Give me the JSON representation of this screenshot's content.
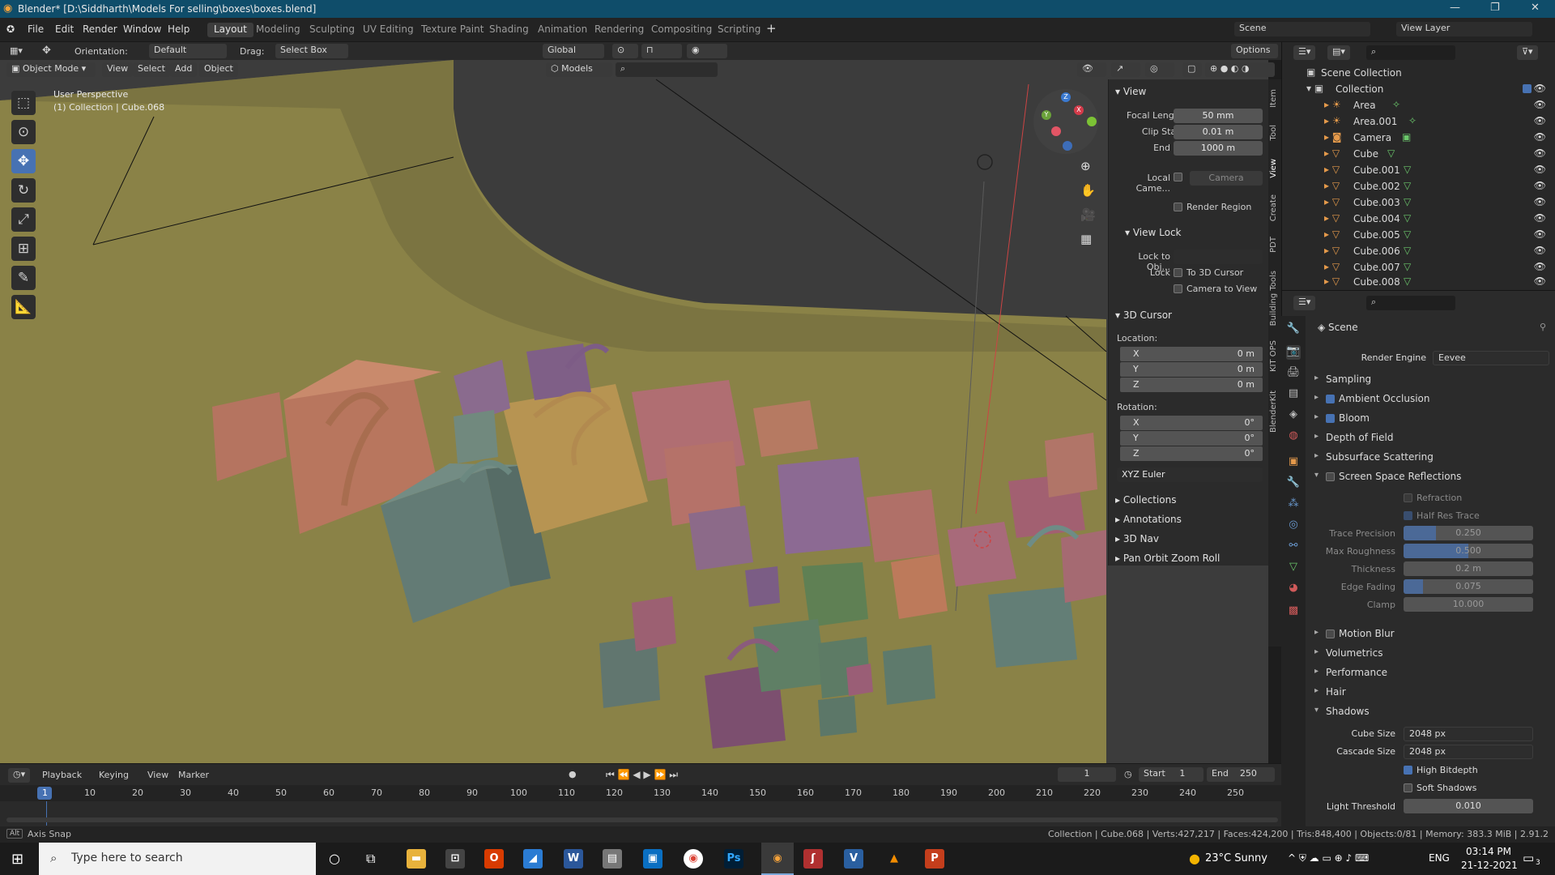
{
  "title_bar": {
    "title": "Blender* [D:\\Siddharth\\Models For selling\\boxes\\boxes.blend]"
  },
  "menu": [
    "File",
    "Edit",
    "Render",
    "Window",
    "Help"
  ],
  "workspaces": [
    "Layout",
    "Modeling",
    "Sculpting",
    "UV Editing",
    "Texture Paint",
    "Shading",
    "Animation",
    "Rendering",
    "Compositing",
    "Scripting"
  ],
  "scene_selector": "Scene",
  "view_layer": "View Layer",
  "tool_header": {
    "orientation_label": "Orientation:",
    "orientation_value": "Default",
    "drag_label": "Drag:",
    "drag_value": "Select Box",
    "transform_orientation": "Global",
    "options": "Options"
  },
  "viewport_header": {
    "mode": "Object Mode",
    "view": "View",
    "select": "Select",
    "add": "Add",
    "object": "Object",
    "asset_lib": "Models"
  },
  "viewport_overlay": {
    "perspective": "User Perspective",
    "collection": "(1) Collection | Cube.068"
  },
  "npanel": {
    "view_section": "View",
    "focal_length_label": "Focal Length",
    "focal_length": "50 mm",
    "clip_start_label": "Clip Start",
    "clip_start": "0.01 m",
    "end_label": "End",
    "clip_end": "1000 m",
    "local_camera_label": "Local Came...",
    "local_camera_value": "Camera",
    "render_region": "Render Region",
    "view_lock_section": "View Lock",
    "lock_to_obj_label": "Lock to Obj...",
    "lock_label": "Lock",
    "to_3d_cursor": "To 3D Cursor",
    "camera_to_view": "Camera to View",
    "cursor_section": "3D Cursor",
    "location_label": "Location:",
    "loc_x": "0 m",
    "loc_y": "0 m",
    "loc_z": "0 m",
    "rotation_label": "Rotation:",
    "rot_x": "0°",
    "rot_y": "0°",
    "rot_z": "0°",
    "rotation_mode": "XYZ Euler",
    "collections": "Collections",
    "annotations": "Annotations",
    "nav_3d": "3D Nav",
    "pan_orbit": "Pan Orbit Zoom Roll",
    "tabs": [
      "Item",
      "Tool",
      "View",
      "Create",
      "PDT",
      "Building Tools",
      "KIT OPS",
      "BlenderKit"
    ]
  },
  "outliner": {
    "scene_collection": "Scene Collection",
    "collection": "Collection",
    "items": [
      "Area",
      "Area.001",
      "Camera",
      "Cube",
      "Cube.001",
      "Cube.002",
      "Cube.003",
      "Cube.004",
      "Cube.005",
      "Cube.006",
      "Cube.007",
      "Cube.008"
    ]
  },
  "properties": {
    "scene": "Scene",
    "render_engine_label": "Render Engine",
    "render_engine": "Eevee",
    "sampling": "Sampling",
    "ambient_occlusion": "Ambient Occlusion",
    "bloom": "Bloom",
    "depth_of_field": "Depth of Field",
    "subsurface_scattering": "Subsurface Scattering",
    "ssr": "Screen Space Reflections",
    "refraction": "Refraction",
    "half_res_trace": "Half Res Trace",
    "trace_precision_label": "Trace Precision",
    "trace_precision": "0.250",
    "max_roughness_label": "Max Roughness",
    "max_roughness": "0.500",
    "thickness_label": "Thickness",
    "thickness": "0.2 m",
    "edge_fading_label": "Edge Fading",
    "edge_fading": "0.075",
    "clamp_label": "Clamp",
    "clamp": "10.000",
    "motion_blur": "Motion Blur",
    "volumetrics": "Volumetrics",
    "performance": "Performance",
    "hair": "Hair",
    "shadows": "Shadows",
    "cube_size_label": "Cube Size",
    "cube_size": "2048 px",
    "cascade_size_label": "Cascade Size",
    "cascade_size": "2048 px",
    "high_bitdepth": "High Bitdepth",
    "soft_shadows": "Soft Shadows",
    "light_threshold_label": "Light Threshold",
    "light_threshold": "0.010"
  },
  "timeline": {
    "playback": "Playback",
    "keying": "Keying",
    "view": "View",
    "marker": "Marker",
    "current_frame": "1",
    "start_label": "Start",
    "start": "1",
    "end_label": "End",
    "end": "250",
    "ticks": [
      "1",
      "10",
      "20",
      "30",
      "40",
      "50",
      "60",
      "70",
      "80",
      "90",
      "100",
      "110",
      "120",
      "130",
      "140",
      "150",
      "160",
      "170",
      "180",
      "190",
      "200",
      "210",
      "220",
      "230",
      "240",
      "250"
    ]
  },
  "statusbar": {
    "hint": "Axis Snap",
    "stats": "Collection | Cube.068 | Verts:427,217 | Faces:424,200 | Tris:848,400 | Objects:0/81 | Memory: 383.3 MiB | 2.91.2"
  },
  "taskbar": {
    "search_placeholder": "Type here to search",
    "weather": "23°C  Sunny",
    "language": "ENG",
    "time": "03:14 PM",
    "date": "21-12-2021",
    "notif_count": "3"
  },
  "colors": {
    "accent": "#4772b3",
    "titlebar": "#0f4d6a",
    "floor": "#8d8548"
  }
}
